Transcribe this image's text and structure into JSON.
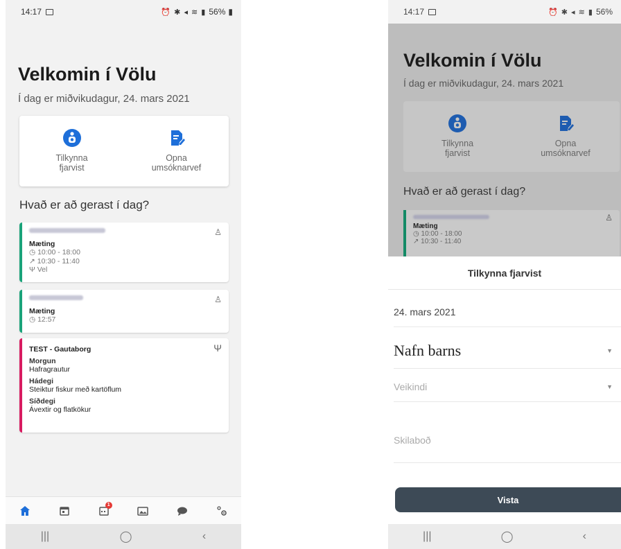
{
  "left": {
    "status": {
      "time": "14:17",
      "battery": "56%"
    },
    "title": "Velkomin í Völu",
    "date": "Í dag er miðvikudagur, 24. mars 2021",
    "actions": [
      {
        "label": "Tilkynna\nfjarvist",
        "icon": "person-info-icon"
      },
      {
        "label": "Opna\numsóknarvef",
        "icon": "document-edit-icon"
      }
    ],
    "section_title": "Hvað er að gerast í dag?",
    "cards": [
      {
        "color": "#1aa37a",
        "type": "Mæting",
        "time1": "10:00 - 18:00",
        "time2": "10:30 - 11:40",
        "food": "Vel"
      },
      {
        "color": "#1aa37a",
        "type": "Mæting",
        "time1": "12:57"
      },
      {
        "color": "#d81b60",
        "title": "TEST - Gautaborg",
        "meals": [
          {
            "heading": "Morgun",
            "text": "Hafragrautur"
          },
          {
            "heading": "Hádegi",
            "text": "Steiktur fiskur með kartöflum"
          },
          {
            "heading": "Síðdegi",
            "text": "Ávextir og flatkökur"
          }
        ]
      }
    ],
    "nav": [
      {
        "icon": "home-icon",
        "active": true
      },
      {
        "icon": "calendar-icon"
      },
      {
        "icon": "calendar-badge-icon",
        "badge": "1"
      },
      {
        "icon": "gallery-icon"
      },
      {
        "icon": "chat-icon"
      },
      {
        "icon": "settings-icon"
      }
    ],
    "sysnav": [
      "|||",
      "◯",
      "‹"
    ]
  },
  "right": {
    "status": {
      "time": "14:17",
      "battery": "56%"
    },
    "title": "Velkomin í Völu",
    "date": "Í dag er miðvikudagur, 24. mars 2021",
    "actions": [
      {
        "label": "Tilkynna\nfjarvist"
      },
      {
        "label": "Opna\numsóknarvef"
      }
    ],
    "section_title": "Hvað er að gerast í dag?",
    "card": {
      "type": "Mæting",
      "time1": "10:00 - 18:00",
      "time2": "10:30 - 11:40"
    },
    "sheet": {
      "title": "Tilkynna fjarvist",
      "date_value": "24. mars 2021",
      "child_label": "Nafn barns",
      "reason_placeholder": "Veikindi",
      "message_placeholder": "Skilaboð",
      "save_label": "Vista"
    },
    "sysnav": [
      "|||",
      "◯",
      "‹"
    ]
  },
  "colors": {
    "accent": "#1e6fd9",
    "green": "#1aa37a",
    "pink": "#d81b60",
    "save": "#3d4a56",
    "badge": "#e53935"
  }
}
